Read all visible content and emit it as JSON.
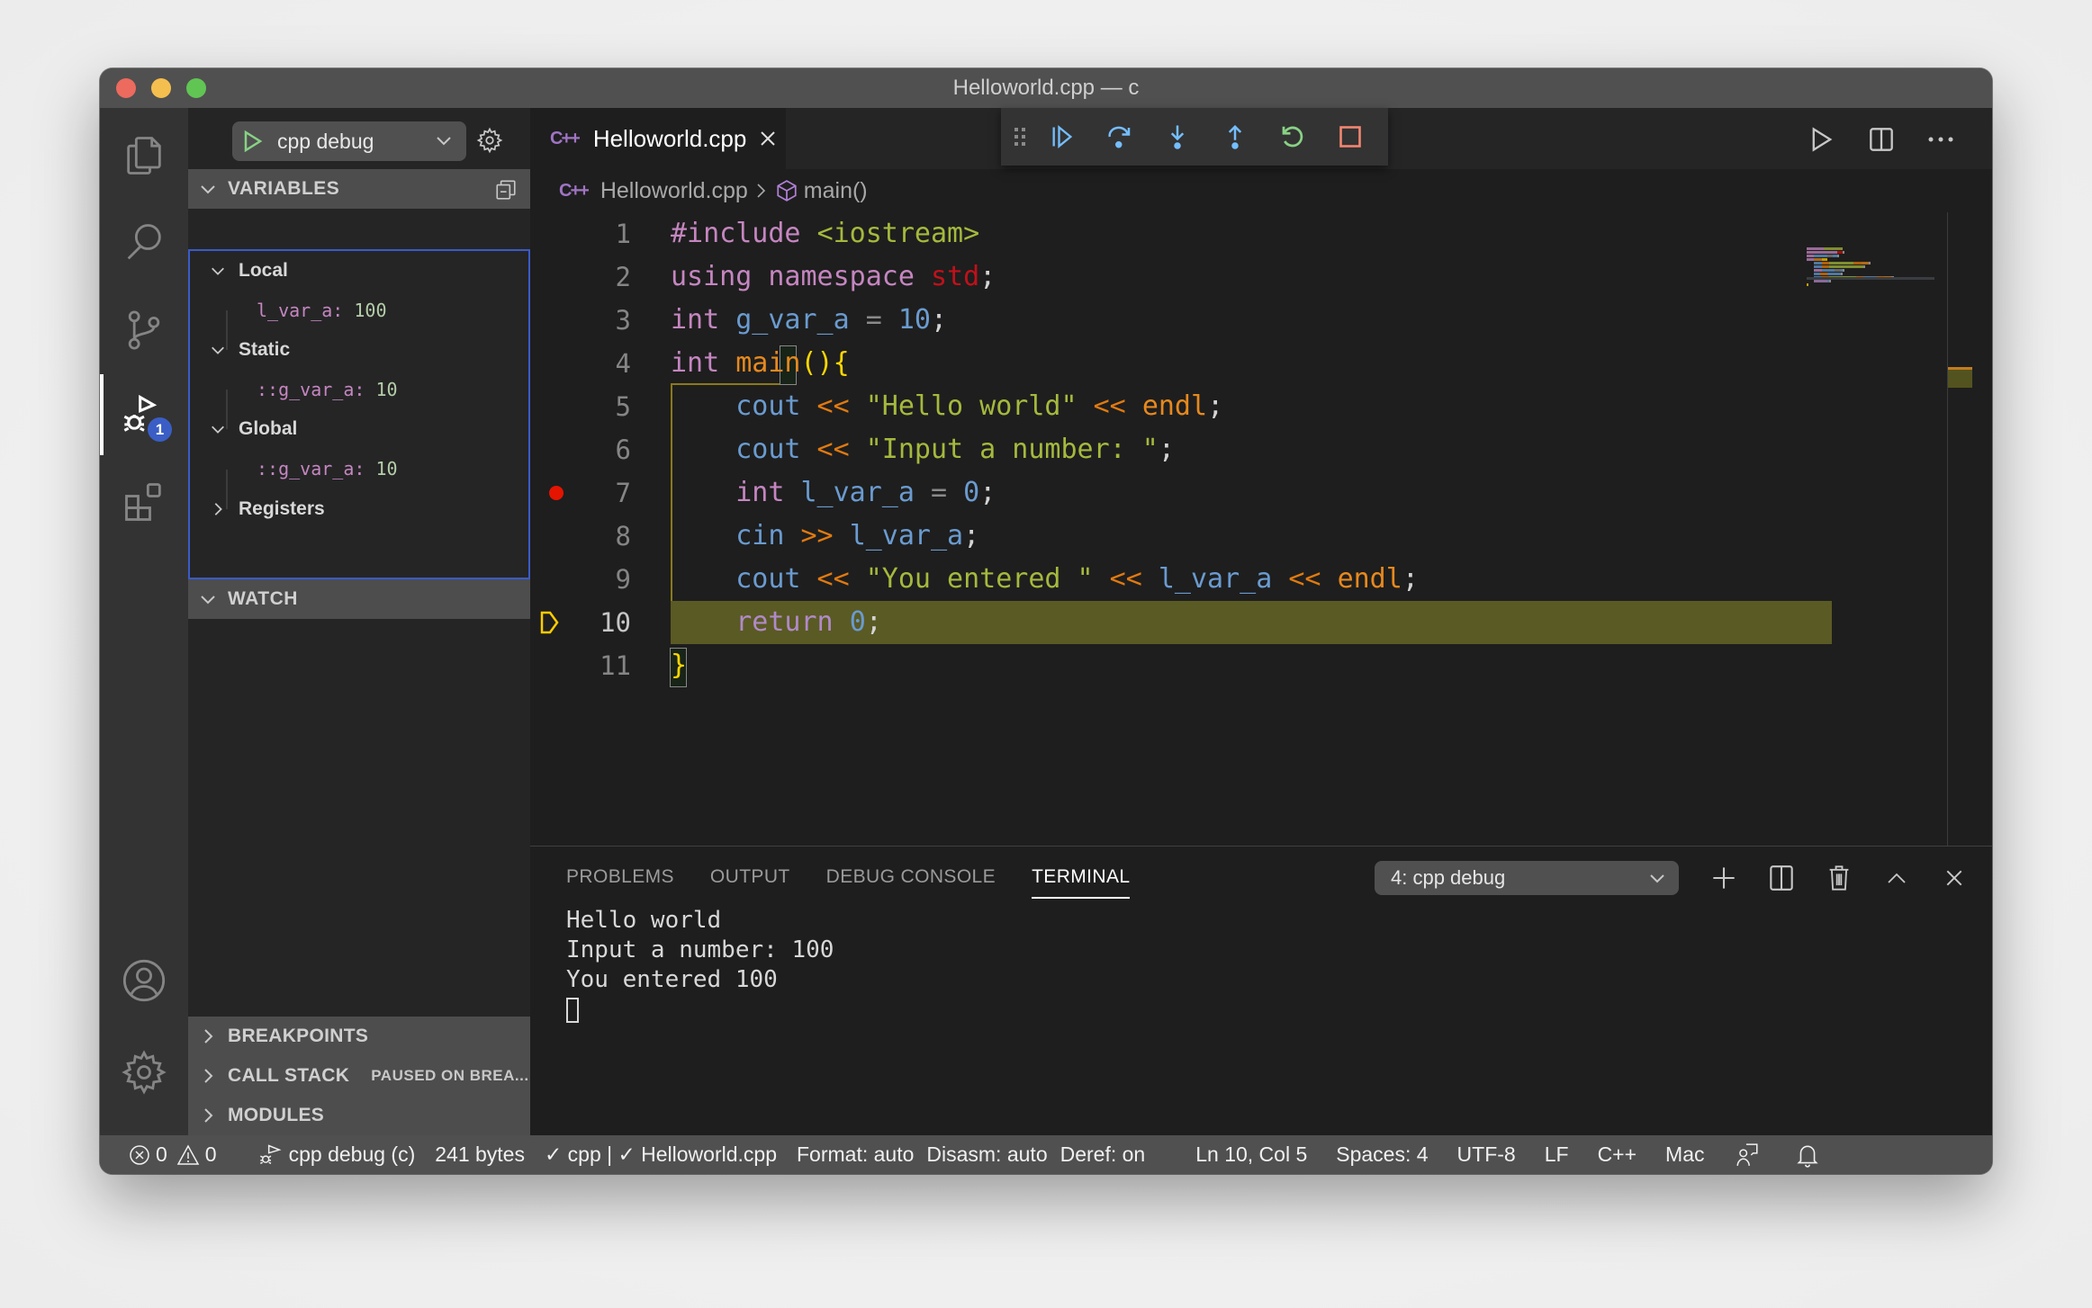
{
  "window": {
    "title": "Helloworld.cpp — c"
  },
  "activity_bar": {
    "items": [
      {
        "name": "explorer",
        "icon": "files-icon"
      },
      {
        "name": "search",
        "icon": "search-icon"
      },
      {
        "name": "source-control",
        "icon": "source-control-icon"
      },
      {
        "name": "run-debug",
        "icon": "debug-icon",
        "active": true,
        "badge": "1"
      },
      {
        "name": "extensions",
        "icon": "extensions-icon"
      }
    ],
    "bottom": [
      {
        "name": "accounts",
        "icon": "account-icon"
      },
      {
        "name": "manage",
        "icon": "gear-icon"
      }
    ],
    "debug_badge": "1"
  },
  "sidebar": {
    "launch_config": "cpp debug",
    "variables_header": "VARIABLES",
    "scopes": [
      {
        "label": "Local",
        "expanded": true,
        "vars": [
          {
            "name": "l_var_a",
            "value": "100"
          }
        ]
      },
      {
        "label": "Static",
        "expanded": true,
        "vars": [
          {
            "name": "::g_var_a",
            "value": "10"
          }
        ]
      },
      {
        "label": "Global",
        "expanded": true,
        "vars": [
          {
            "name": "::g_var_a",
            "value": "10"
          }
        ]
      },
      {
        "label": "Registers",
        "expanded": false,
        "vars": []
      }
    ],
    "watch_header": "WATCH",
    "breakpoints_header": "BREAKPOINTS",
    "call_stack_header": "CALL STACK",
    "call_stack_status": "PAUSED ON BREA...",
    "modules_header": "MODULES"
  },
  "editor": {
    "tab": {
      "label": "Helloworld.cpp",
      "icon": "cpp-icon",
      "icon_text": "C++"
    },
    "breadcrumb": {
      "file": "Helloworld.cpp",
      "symbol": "main()"
    },
    "debug_toolbar": [
      "drag-handle",
      "continue",
      "step-over",
      "step-into",
      "step-out",
      "restart",
      "stop"
    ],
    "breakpoint_line": 7,
    "current_line": 10,
    "lines": [
      {
        "n": "1",
        "tokens": [
          [
            "pp",
            "#include "
          ],
          [
            "str",
            "<iostream>"
          ]
        ]
      },
      {
        "n": "2",
        "tokens": [
          [
            "kw",
            "using namespace "
          ],
          [
            "std",
            "std"
          ],
          [
            "punc",
            ";"
          ]
        ]
      },
      {
        "n": "3",
        "tokens": [
          [
            "kw",
            "int "
          ],
          [
            "var",
            "g_var_a"
          ],
          [
            "eq",
            " = "
          ],
          [
            "num",
            "10"
          ],
          [
            "punc",
            ";"
          ]
        ]
      },
      {
        "n": "4",
        "tokens": [
          [
            "kw",
            "int "
          ],
          [
            "fn",
            "main"
          ],
          [
            "br",
            "(){"
          ]
        ]
      },
      {
        "n": "5",
        "tokens": [
          [
            "punc",
            "    "
          ],
          [
            "var",
            "cout"
          ],
          [
            "op",
            " << "
          ],
          [
            "str",
            "\"Hello world\""
          ],
          [
            "op",
            " << "
          ],
          [
            "fn",
            "endl"
          ],
          [
            "punc",
            ";"
          ]
        ]
      },
      {
        "n": "6",
        "tokens": [
          [
            "punc",
            "    "
          ],
          [
            "var",
            "cout"
          ],
          [
            "op",
            " << "
          ],
          [
            "str",
            "\"Input a number: \""
          ],
          [
            "punc",
            ";"
          ]
        ]
      },
      {
        "n": "7",
        "tokens": [
          [
            "punc",
            "    "
          ],
          [
            "kw",
            "int "
          ],
          [
            "var",
            "l_var_a"
          ],
          [
            "eq",
            " = "
          ],
          [
            "num",
            "0"
          ],
          [
            "punc",
            ";"
          ]
        ]
      },
      {
        "n": "8",
        "tokens": [
          [
            "punc",
            "    "
          ],
          [
            "var",
            "cin"
          ],
          [
            "op",
            " >> "
          ],
          [
            "var",
            "l_var_a"
          ],
          [
            "punc",
            ";"
          ]
        ]
      },
      {
        "n": "9",
        "tokens": [
          [
            "punc",
            "    "
          ],
          [
            "var",
            "cout"
          ],
          [
            "op",
            " << "
          ],
          [
            "str",
            "\"You entered \""
          ],
          [
            "op",
            " << "
          ],
          [
            "var",
            "l_var_a"
          ],
          [
            "op",
            " << "
          ],
          [
            "fn",
            "endl"
          ],
          [
            "punc",
            ";"
          ]
        ]
      },
      {
        "n": "10",
        "tokens": [
          [
            "punc",
            "    "
          ],
          [
            "kw2",
            "return "
          ],
          [
            "num",
            "0"
          ],
          [
            "punc",
            ";"
          ]
        ]
      },
      {
        "n": "11",
        "tokens": [
          [
            "br",
            "}"
          ]
        ]
      }
    ]
  },
  "panel": {
    "tabs": [
      {
        "label": "PROBLEMS",
        "active": false
      },
      {
        "label": "OUTPUT",
        "active": false
      },
      {
        "label": "DEBUG CONSOLE",
        "active": false
      },
      {
        "label": "TERMINAL",
        "active": true
      }
    ],
    "terminal_select": "4: cpp debug",
    "terminal_lines": [
      "Hello world",
      "Input a number: 100",
      "You entered 100"
    ]
  },
  "statusbar": {
    "errors": "0",
    "warnings": "0",
    "debug_target": "cpp debug (c)",
    "file_size": "241 bytes",
    "cpp_status": "✓ cpp | ✓ Helloworld.cpp",
    "format": "Format: auto",
    "disasm": "Disasm: auto",
    "deref": "Deref: on",
    "position": "Ln 10, Col 5",
    "spaces": "Spaces: 4",
    "encoding": "UTF-8",
    "eol": "LF",
    "language": "C++",
    "platform": "Mac"
  },
  "colors": {
    "accent_blue": "#3a5bc7",
    "breakpoint": "#e51400",
    "current_line_bg": "#5a5a24",
    "debug_continue": "#75beff",
    "debug_restart": "#89d185",
    "debug_stop": "#f48771"
  }
}
